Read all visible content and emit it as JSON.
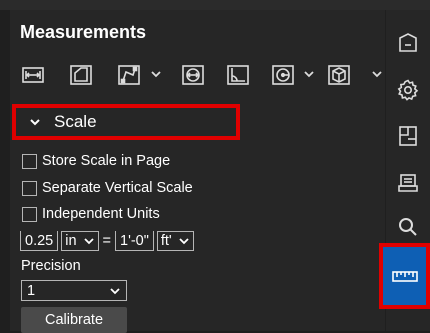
{
  "panel": {
    "title": "Measurements"
  },
  "scale": {
    "header_label": "Scale",
    "checkboxes": [
      {
        "label": "Store Scale in Page",
        "checked": false
      },
      {
        "label": "Separate Vertical Scale",
        "checked": false
      },
      {
        "label": "Independent Units",
        "checked": false
      }
    ],
    "units": {
      "page_value": "0.25",
      "page_unit": "in",
      "equals": "=",
      "world_value": "1'-0\"",
      "world_unit": "ft'"
    },
    "precision_label": "Precision",
    "precision_value": "1",
    "calibrate_label": "Calibrate"
  },
  "toolbar": {
    "tools": [
      "length-icon",
      "area-icon",
      "polylength-icon",
      "diameter-icon",
      "angle-icon",
      "radius-icon",
      "volume-icon"
    ]
  },
  "sidebar": {
    "items": [
      "markup-icon",
      "settings-icon",
      "spaces-icon",
      "sketch-icon",
      "search-icon",
      "measurements-icon"
    ],
    "active": "measurements-icon"
  },
  "colors": {
    "background": "#1f1f1f",
    "panel": "#262626",
    "highlight": "#e00000",
    "active": "#0e5fb4",
    "icon": "#dcdcdc"
  }
}
